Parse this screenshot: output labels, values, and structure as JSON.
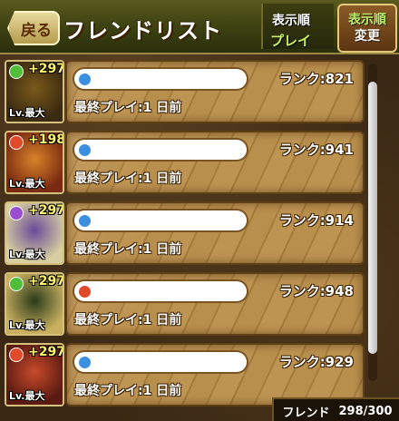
{
  "header": {
    "back_label": "戻る",
    "title": "フレンドリスト",
    "sort_title": "表示順",
    "sort_value": "プレイ",
    "sort_button_line1": "表示順",
    "sort_button_line2": "変更"
  },
  "friends": [
    {
      "plus": "+297",
      "level": "Lv.最大",
      "orb_color": "#4fbf3a",
      "name": "",
      "rank": "ランク:821",
      "last_play": "最終プレイ:1  日前"
    },
    {
      "plus": "+198",
      "level": "Lv.最大",
      "orb_color": "#e04a2a",
      "name": "",
      "rank": "ランク:941",
      "last_play": "最終プレイ:1  日前"
    },
    {
      "plus": "+297",
      "level": "Lv.最大",
      "orb_color": "#9a4fd0",
      "name": "",
      "rank": "ランク:914",
      "last_play": "最終プレイ:1  日前"
    },
    {
      "plus": "+297",
      "level": "Lv.最大",
      "orb_color": "#4fbf3a",
      "name": "",
      "rank": "ランク:948",
      "last_play": "最終プレイ:1  日前"
    },
    {
      "plus": "+297",
      "level": "Lv.最大",
      "orb_color": "#e04a2a",
      "name": "",
      "rank": "ランク:929",
      "last_play": "最終プレイ:1  日前"
    }
  ],
  "name_orb_colors": [
    "#3b8fe0",
    "#3b8fe0",
    "#3b8fe0",
    "#e04a2a",
    "#3b8fe0"
  ],
  "portrait_colors": [
    [
      "#3a2a10",
      "#7a5a1a"
    ],
    [
      "#7a2a10",
      "#d8832a"
    ],
    [
      "#d8d0a0",
      "#6a4a9a"
    ],
    [
      "#c8b060",
      "#2a3a1a"
    ],
    [
      "#5a1a12",
      "#c84a2a"
    ]
  ],
  "footer": {
    "label": "フレンド",
    "count": "298/300"
  }
}
